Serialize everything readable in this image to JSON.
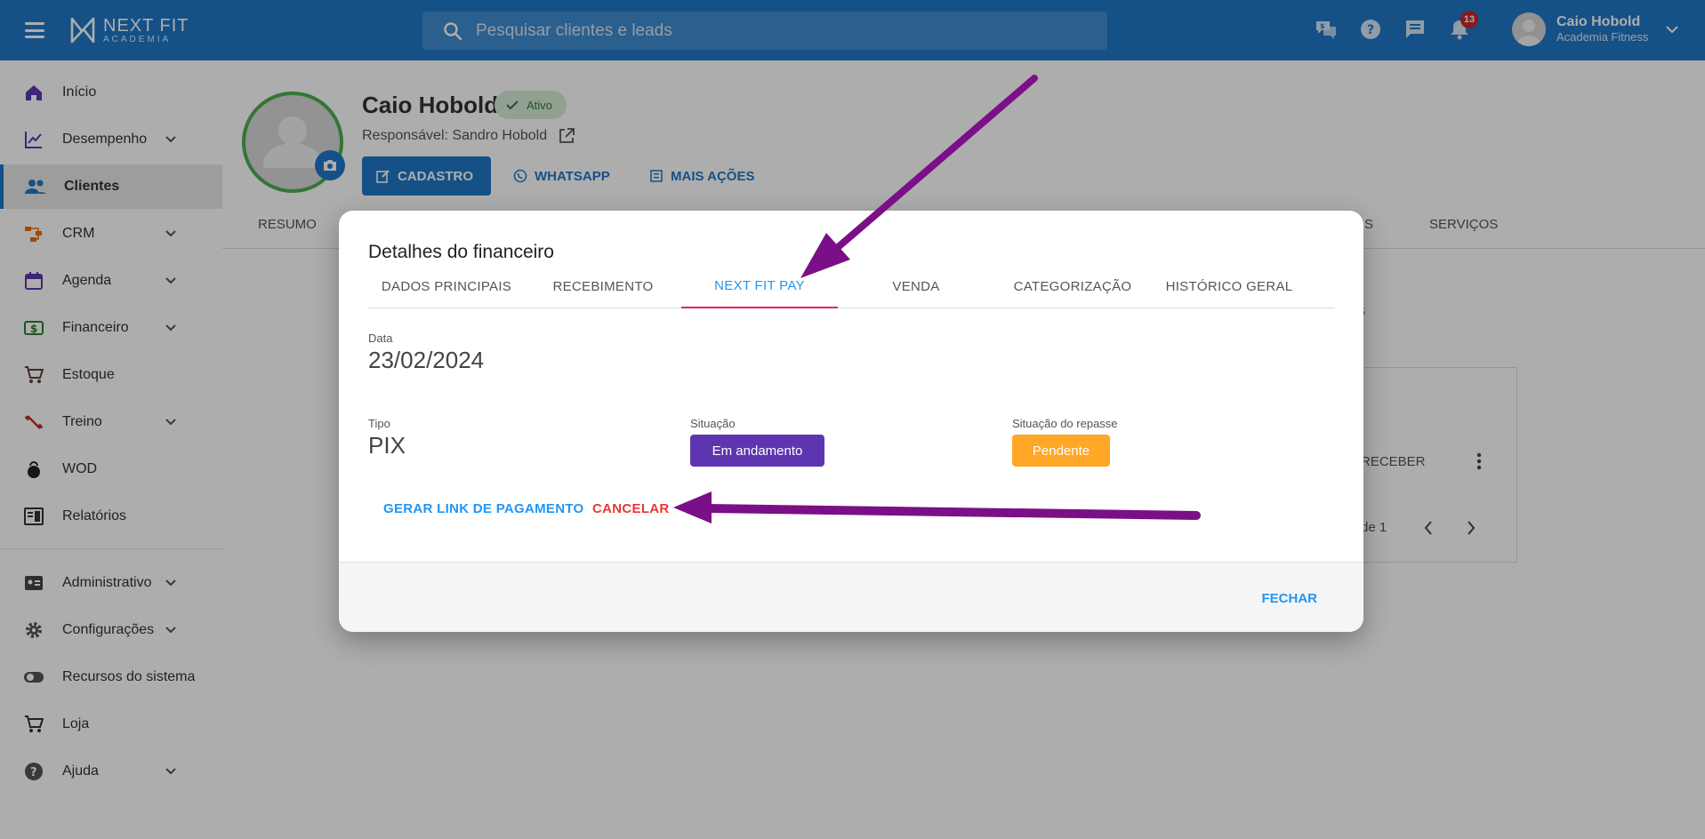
{
  "brand": {
    "title": "NEXT FIT",
    "subtitle": "ACADEMIA"
  },
  "search": {
    "placeholder": "Pesquisar clientes e leads"
  },
  "notifications": {
    "count": "13"
  },
  "user": {
    "name": "Caio Hobold",
    "subtitle": "Academia Fitness"
  },
  "sidebar": {
    "items": [
      {
        "label": "Início",
        "icon": "home-icon"
      },
      {
        "label": "Desempenho",
        "icon": "chart-line-icon",
        "expandable": true
      },
      {
        "label": "Clientes",
        "icon": "people-icon",
        "active": true
      },
      {
        "label": "CRM",
        "icon": "crm-icon",
        "expandable": true
      },
      {
        "label": "Agenda",
        "icon": "calendar-icon",
        "expandable": true
      },
      {
        "label": "Financeiro",
        "icon": "money-icon",
        "expandable": true
      },
      {
        "label": "Estoque",
        "icon": "cart-icon"
      },
      {
        "label": "Treino",
        "icon": "dumbbell-icon",
        "expandable": true
      },
      {
        "label": "WOD",
        "icon": "kettlebell-icon"
      },
      {
        "label": "Relatórios",
        "icon": "report-icon"
      },
      {
        "label": "Administrativo",
        "icon": "id-card-icon",
        "expandable": true
      },
      {
        "label": "Configurações",
        "icon": "gear-icon",
        "expandable": true
      },
      {
        "label": "Recursos do sistema",
        "icon": "toggle-icon"
      },
      {
        "label": "Loja",
        "icon": "cart-icon"
      },
      {
        "label": "Ajuda",
        "icon": "help-icon",
        "expandable": true
      }
    ]
  },
  "client": {
    "name": "Caio Hobold",
    "status": "Ativo",
    "responsible": "Responsável: Sandro Hobold",
    "actions": {
      "cadastro": "CADASTRO",
      "whatsapp": "WHATSAPP",
      "more": "MAIS AÇÕES"
    },
    "tabs": {
      "resumo": "RESUMO",
      "partial": "S",
      "servicos": "SERVIÇOS"
    }
  },
  "background": {
    "link_partial": "S",
    "receber": "RECEBER",
    "pagination": "de 1"
  },
  "modal": {
    "title": "Detalhes do financeiro",
    "tabs": [
      "DADOS PRINCIPAIS",
      "RECEBIMENTO",
      "NEXT FIT PAY",
      "VENDA",
      "CATEGORIZAÇÃO",
      "HISTÓRICO GERAL"
    ],
    "active_tab": 2,
    "fields": {
      "data_label": "Data",
      "data_value": "23/02/2024",
      "tipo_label": "Tipo",
      "tipo_value": "PIX",
      "situacao_label": "Situação",
      "situacao_value": "Em andamento",
      "repasse_label": "Situação do repasse",
      "repasse_value": "Pendente"
    },
    "actions": {
      "gerar_link": "GERAR LINK DE PAGAMENTO",
      "cancelar": "CANCELAR"
    },
    "footer": {
      "fechar": "FECHAR"
    }
  },
  "colors": {
    "primary": "#1f78c8",
    "tab_active_text": "#2196f3",
    "tab_indicator": "#e91e63",
    "status_purple": "#5e35b1",
    "status_orange": "#ffa726",
    "cancel_red": "#e53935",
    "arrow": "#7b0f87",
    "active_green": "#4caf50"
  }
}
